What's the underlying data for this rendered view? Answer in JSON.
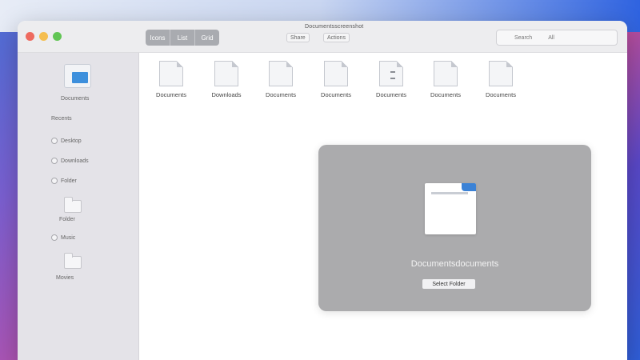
{
  "window": {
    "title": "Documentsscreenshot",
    "controls": [
      "close",
      "minimize",
      "zoom"
    ]
  },
  "toolbar": {
    "view_segments": [
      "Icons",
      "List",
      "Grid"
    ],
    "button_left": "Share",
    "button_right": "Actions",
    "search_placeholder": "Search",
    "search_scope": "All"
  },
  "sidebar": {
    "header_label": "Documents",
    "items": [
      {
        "label": "Recents"
      },
      {
        "label": "Desktop"
      },
      {
        "label": "Downloads"
      },
      {
        "label": "Folder"
      },
      {
        "label": "Music"
      },
      {
        "label": "Movies"
      }
    ]
  },
  "files": [
    {
      "name": "Documents"
    },
    {
      "name": "Downloads"
    },
    {
      "name": "Documents"
    },
    {
      "name": "Documents"
    },
    {
      "name": "Documents"
    },
    {
      "name": "Documents"
    },
    {
      "name": "Documents"
    }
  ],
  "panel": {
    "title": "Documentsdocuments",
    "button_label": "Select Folder"
  }
}
